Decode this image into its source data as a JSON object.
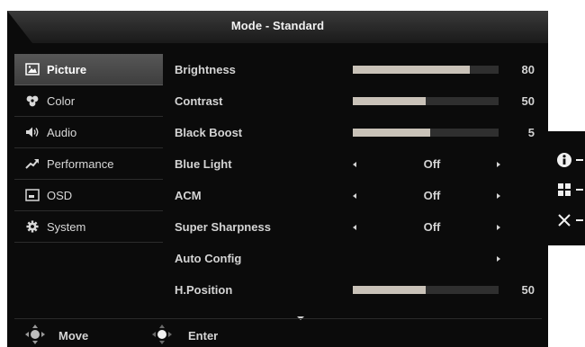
{
  "header": {
    "title": "Mode - Standard"
  },
  "sidebar": {
    "items": [
      {
        "label": "Picture",
        "icon": "picture-icon",
        "active": true
      },
      {
        "label": "Color",
        "icon": "palette-icon"
      },
      {
        "label": "Audio",
        "icon": "speaker-icon"
      },
      {
        "label": "Performance",
        "icon": "trend-up-icon"
      },
      {
        "label": "OSD",
        "icon": "osd-icon"
      },
      {
        "label": "System",
        "icon": "gear-icon"
      }
    ]
  },
  "settings": {
    "brightness": {
      "label": "Brightness",
      "value": 80
    },
    "contrast": {
      "label": "Contrast",
      "value": 50
    },
    "black_boost": {
      "label": "Black Boost",
      "value": 5,
      "bar_level_percent": 53
    },
    "blue_light": {
      "label": "Blue Light",
      "value": "Off"
    },
    "acm": {
      "label": "ACM",
      "value": "Off"
    },
    "super_sharpness": {
      "label": "Super Sharpness",
      "value": "Off"
    },
    "auto_config": {
      "label": "Auto Config"
    },
    "h_position": {
      "label": "H.Position",
      "value": 50
    }
  },
  "footer": {
    "move_label": "Move",
    "enter_label": "Enter"
  },
  "side_panel": {
    "icons": [
      "info-icon",
      "menu-icon",
      "close-icon"
    ]
  },
  "colors": {
    "background": "#0b0b0b",
    "bar_fill": "#c9c2b8",
    "bar_track": "#2f2f2f",
    "active_item": "#4a4a4a",
    "text": "#d4d4d4"
  }
}
